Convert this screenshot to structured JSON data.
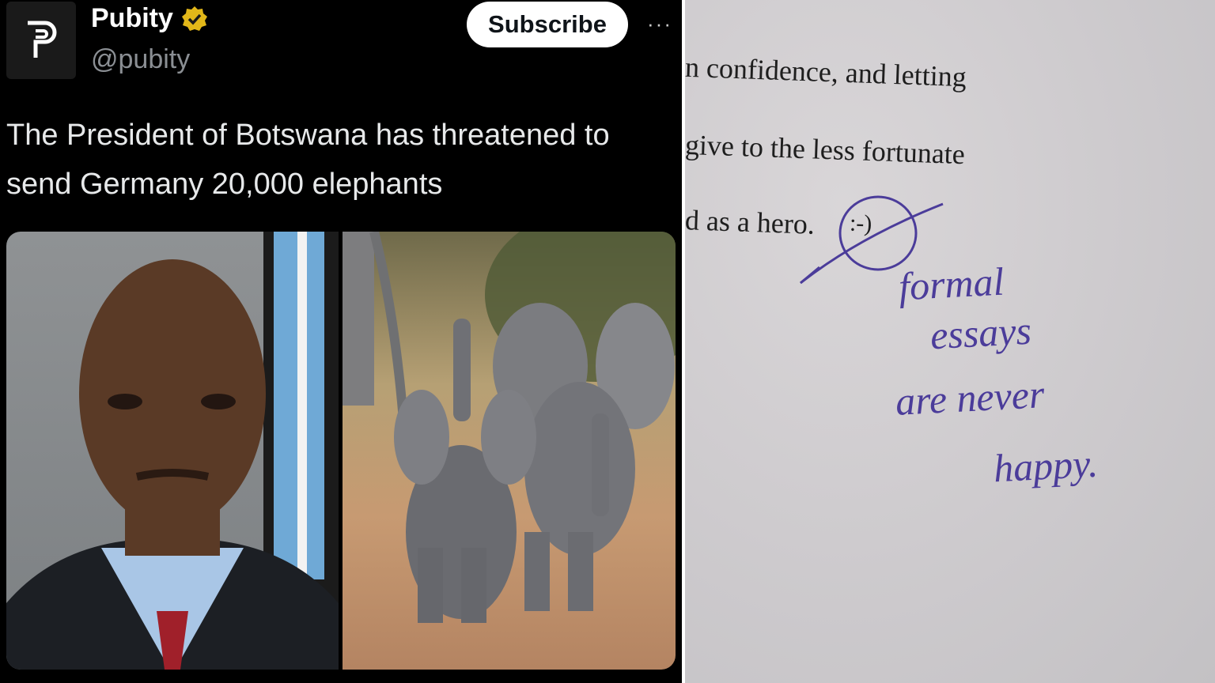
{
  "post": {
    "author_name": "Pubity",
    "author_handle": "@pubity",
    "subscribe_label": "Subscribe",
    "more_label": "···",
    "avatar_letter": "P",
    "text": "The President of Botswana has threatened to send Germany 20,000 elephants",
    "verified_icon": "verified-badge-icon",
    "colors": {
      "background": "#000000",
      "text": "#e7e9ea",
      "handle": "#8b8f94",
      "badge": "#e2b719"
    }
  },
  "media": {
    "images": [
      "portrait-photo",
      "elephants-photo"
    ]
  },
  "essay": {
    "lines": [
      "n confidence, and letting",
      "give to the less fortunate",
      "d as a hero."
    ],
    "emoticon": ":-)",
    "handwritten_note": [
      "formal",
      "essays",
      "are never",
      "happy."
    ],
    "ink_color": "#4b3c9a"
  }
}
